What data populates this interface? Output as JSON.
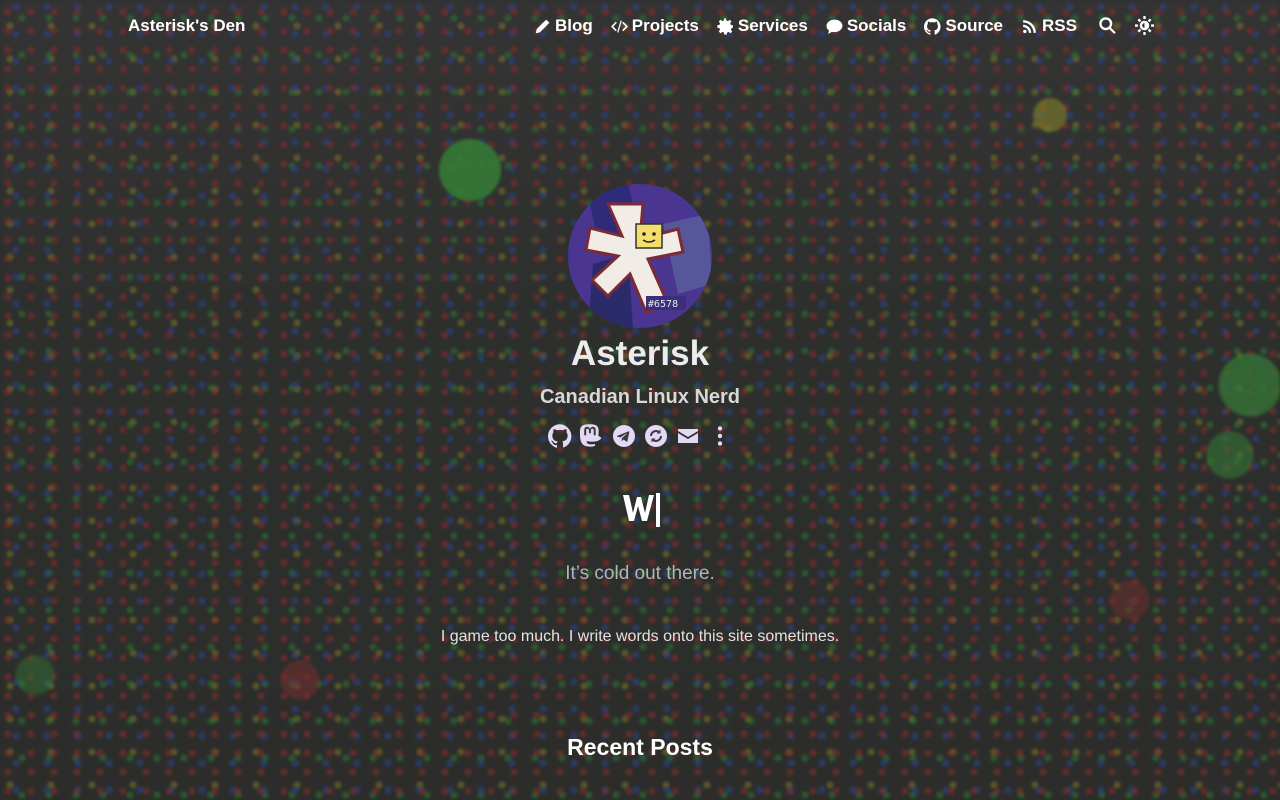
{
  "site": {
    "brand": "Asterisk's Den"
  },
  "nav": {
    "items": [
      {
        "label": "Blog",
        "icon": "pencil-icon"
      },
      {
        "label": "Projects",
        "icon": "code-icon"
      },
      {
        "label": "Services",
        "icon": "gear-icon"
      },
      {
        "label": "Socials",
        "icon": "chat-icon"
      },
      {
        "label": "Source",
        "icon": "github-icon"
      },
      {
        "label": "RSS",
        "icon": "rss-icon"
      }
    ],
    "tools": [
      {
        "icon": "search-icon"
      },
      {
        "icon": "theme-toggle-icon"
      }
    ]
  },
  "profile": {
    "name": "Asterisk",
    "tagline": "Canadian Linux Nerd",
    "avatar_badge": "#6578",
    "socials": [
      {
        "icon": "github-icon"
      },
      {
        "icon": "mastodon-icon"
      },
      {
        "icon": "telegram-icon"
      },
      {
        "icon": "keyoxide-icon"
      },
      {
        "icon": "email-icon"
      },
      {
        "icon": "more-icon"
      }
    ],
    "accent_color": "#e3d9f5"
  },
  "content": {
    "quote": "It’s cold out there.",
    "bio": "I game too much. I write words onto this site sometimes.",
    "recent_heading": "Recent Posts"
  }
}
